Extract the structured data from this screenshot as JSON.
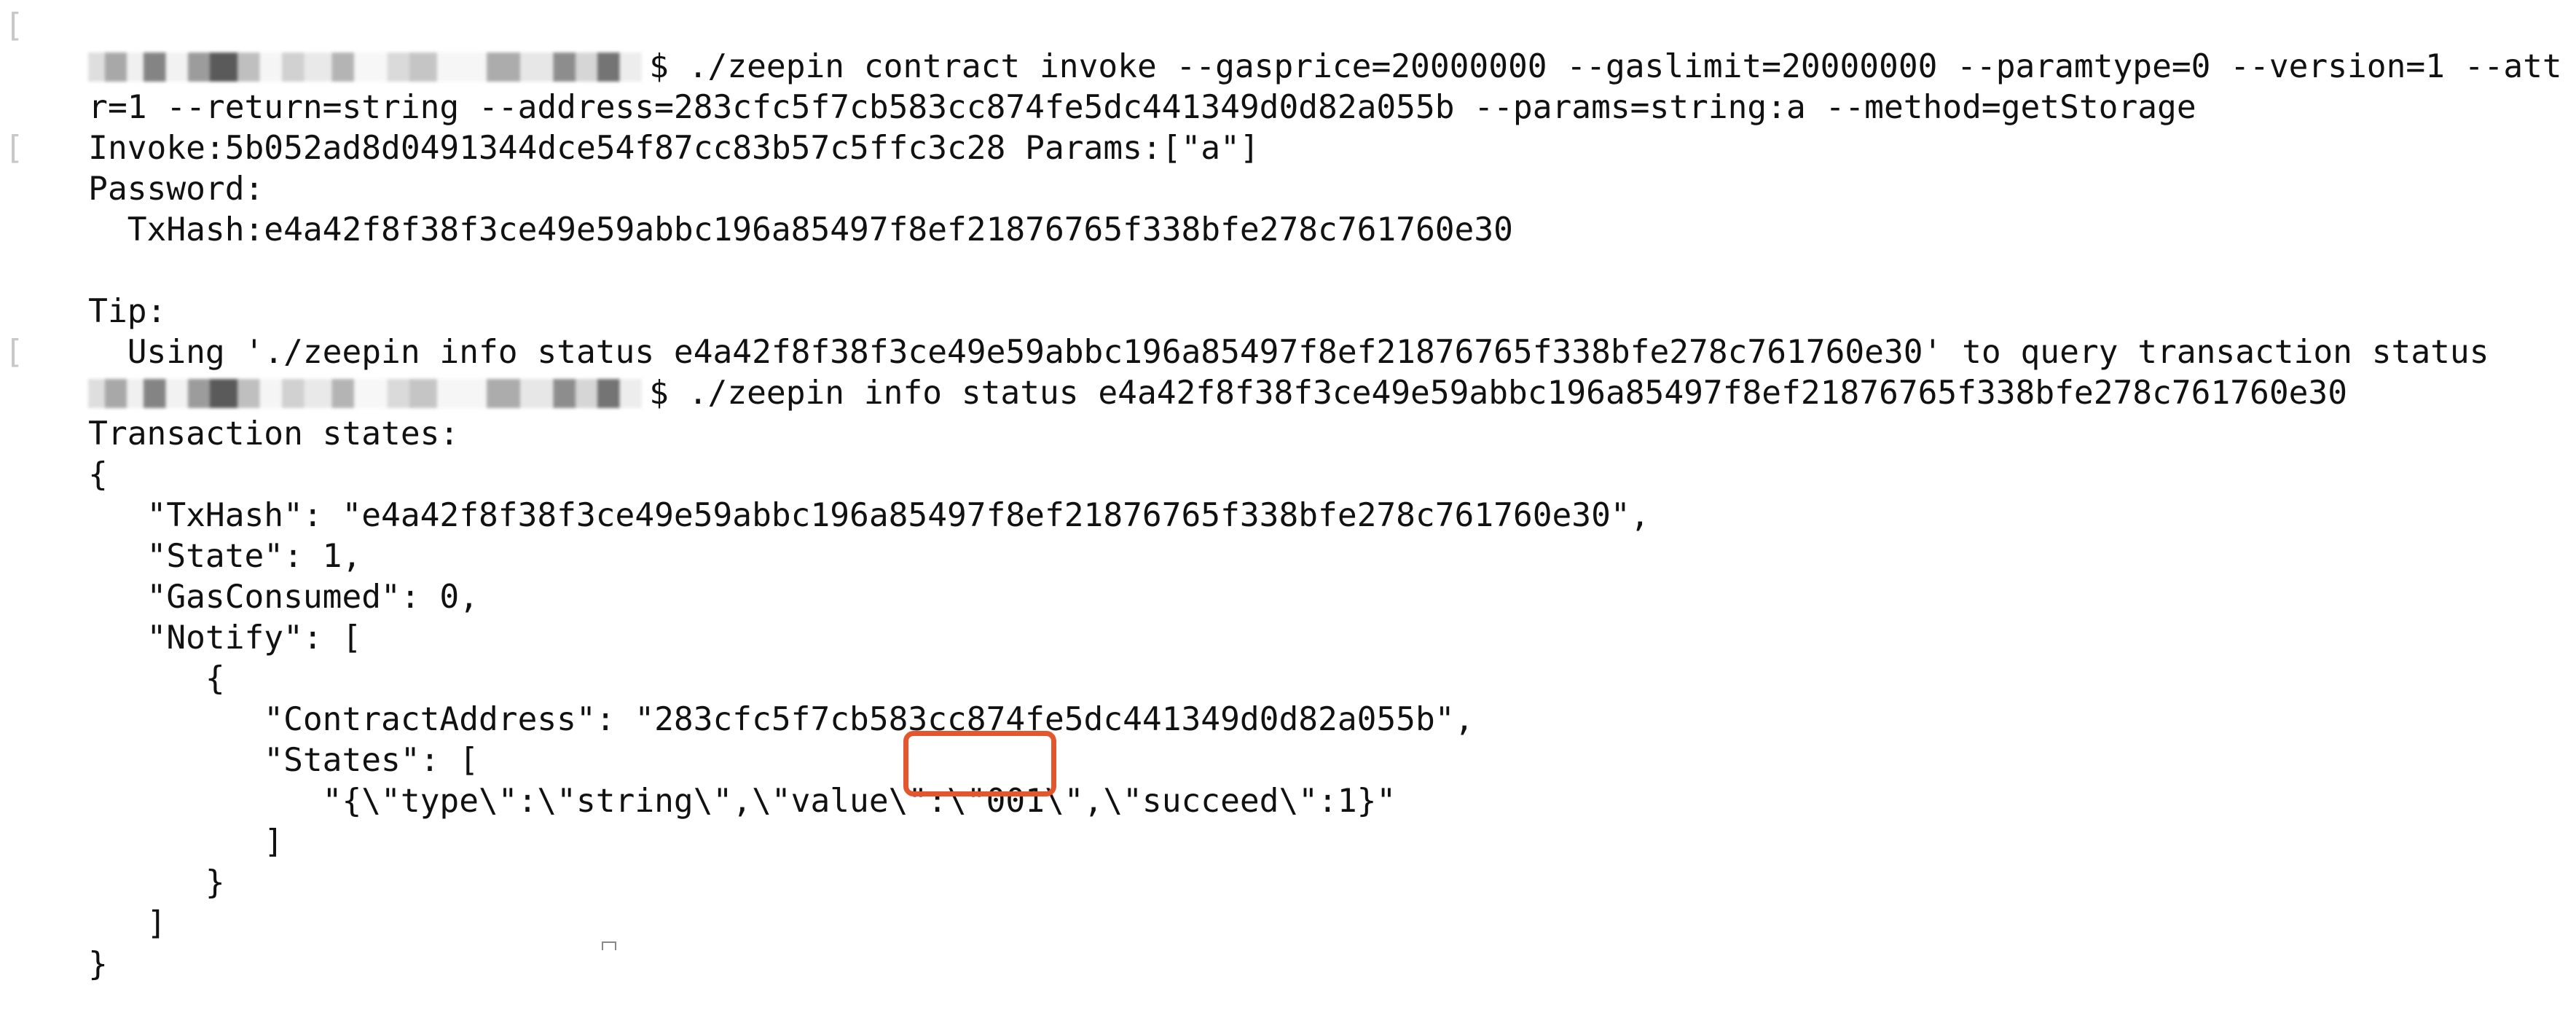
{
  "terminal": {
    "lines": [
      {
        "kind": "prompt",
        "text": "$ ./zeepin contract invoke --gasprice=20000000 --gaslimit=20000000 --paramtype=0 --version=1 --att"
      },
      {
        "kind": "text",
        "text": "r=1 --return=string --address=283cfc5f7cb583cc874fe5dc441349d0d82a055b --params=string:a --method=getStorage"
      },
      {
        "kind": "text",
        "text": "Invoke:5b052ad8d0491344dce54f87cc83b57c5ffc3c28 Params:[\"a\"]"
      },
      {
        "kind": "text",
        "text": "Password:"
      },
      {
        "kind": "text",
        "text": "  TxHash:e4a42f8f38f3ce49e59abbc196a85497f8ef21876765f338bfe278c761760e30"
      },
      {
        "kind": "text",
        "text": ""
      },
      {
        "kind": "text",
        "text": "Tip:"
      },
      {
        "kind": "text",
        "text": "  Using './zeepin info status e4a42f8f38f3ce49e59abbc196a85497f8ef21876765f338bfe278c761760e30' to query transaction status"
      },
      {
        "kind": "prompt",
        "text": "$ ./zeepin info status e4a42f8f38f3ce49e59abbc196a85497f8ef21876765f338bfe278c761760e30"
      },
      {
        "kind": "text",
        "text": "Transaction states:"
      },
      {
        "kind": "text",
        "text": "{"
      },
      {
        "kind": "text",
        "text": "   \"TxHash\": \"e4a42f8f38f3ce49e59abbc196a85497f8ef21876765f338bfe278c761760e30\","
      },
      {
        "kind": "text",
        "text": "   \"State\": 1,"
      },
      {
        "kind": "text",
        "text": "   \"GasConsumed\": 0,"
      },
      {
        "kind": "text",
        "text": "   \"Notify\": ["
      },
      {
        "kind": "text",
        "text": "      {"
      },
      {
        "kind": "text",
        "text": "         \"ContractAddress\": \"283cfc5f7cb583cc874fe5dc441349d0d82a055b\","
      },
      {
        "kind": "text",
        "text": "         \"States\": ["
      },
      {
        "kind": "text",
        "text": "            \"{\\\"type\\\":\\\"string\\\",\\\"value\\\":\\\"001\\\",\\\"succeed\\\":1}\""
      },
      {
        "kind": "text",
        "text": "         ]"
      },
      {
        "kind": "text",
        "text": "      }"
      },
      {
        "kind": "text",
        "text": "   ]"
      },
      {
        "kind": "text",
        "text": "}"
      }
    ],
    "highlight": {
      "text": "\\\"001\\\"",
      "color": "#e4572e"
    },
    "colors": {
      "background": "#ffffff",
      "foreground": "#111111",
      "bracket": "#c8c8c8"
    }
  }
}
